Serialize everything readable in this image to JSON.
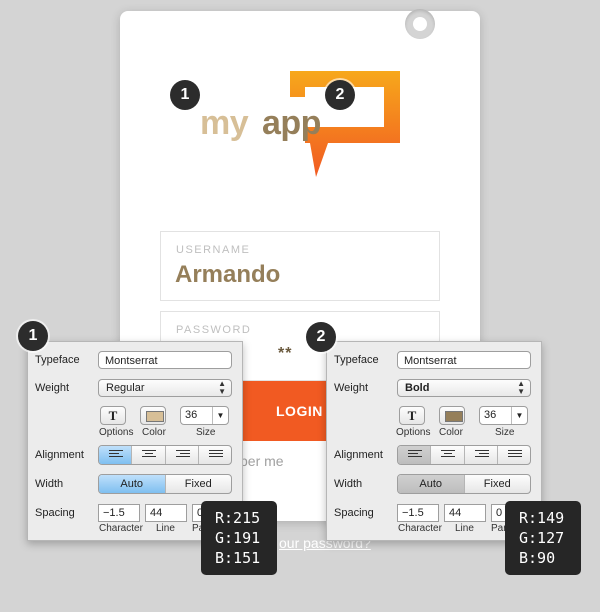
{
  "login_card": {
    "logo": {
      "word1": "my",
      "word2": "app",
      "colors": {
        "my": "#d7bf97",
        "app": "#957f5a",
        "bubble_top": "#f7a81b",
        "bubble_bottom": "#f15a22"
      }
    },
    "username": {
      "label": "USERNAME",
      "value": "Armando"
    },
    "password": {
      "label": "PASSWORD",
      "value_visible": "**"
    },
    "login_button": {
      "label": "LOGIN",
      "color": "#f15a22"
    },
    "remember_fragment": "ber me",
    "forgot_fragment": "our password?"
  },
  "badges": [
    "1",
    "2",
    "1",
    "2"
  ],
  "panels": [
    {
      "typeface_label": "Typeface",
      "typeface": "Montserrat",
      "weight_label": "Weight",
      "weight": "Regular",
      "options_caption": "Options",
      "color_caption": "Color",
      "size_caption": "Size",
      "size": "36",
      "swatch": "#d7bf97",
      "alignment_label": "Alignment",
      "width_label": "Width",
      "width_auto": "Auto",
      "width_fixed": "Fixed",
      "spacing_label": "Spacing",
      "character": "−1.5",
      "line": "44",
      "paragraph": "0",
      "character_caption": "Character",
      "line_caption": "Line",
      "paragraph_caption": "Par"
    },
    {
      "typeface_label": "Typeface",
      "typeface": "Montserrat",
      "weight_label": "Weight",
      "weight": "Bold",
      "options_caption": "Options",
      "color_caption": "Color",
      "size_caption": "Size",
      "size": "36",
      "swatch": "#957f5a",
      "alignment_label": "Alignment",
      "width_label": "Width",
      "width_auto": "Auto",
      "width_fixed": "Fixed",
      "spacing_label": "Spacing",
      "character": "−1.5",
      "line": "44",
      "paragraph": "0",
      "character_caption": "Character",
      "line_caption": "Line",
      "paragraph_caption": "Para"
    }
  ],
  "rgb": [
    {
      "r": "R:215",
      "g": "G:191",
      "b": "B:151"
    },
    {
      "r": "R:149",
      "g": "G:127",
      "b": "B:90"
    }
  ]
}
